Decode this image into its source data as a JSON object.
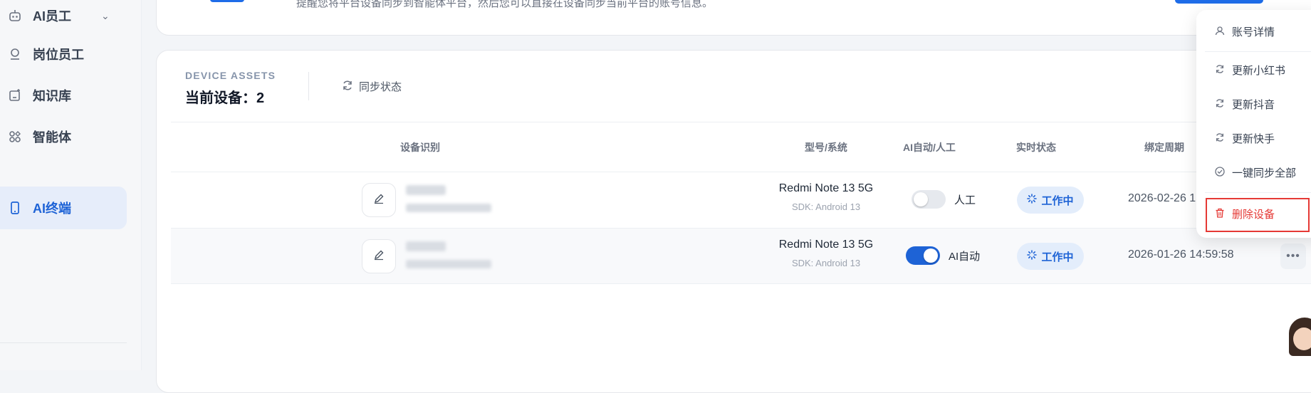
{
  "sidebar": {
    "items": [
      {
        "label": "AI员工",
        "icon": "robot-icon"
      },
      {
        "label": "岗位员工",
        "icon": "user-icon"
      },
      {
        "label": "知识库",
        "icon": "knowledge-base-icon"
      },
      {
        "label": "智能体",
        "icon": "agent-apps-icon"
      },
      {
        "label": "AI终端",
        "icon": "phone-icon",
        "active": true
      }
    ]
  },
  "top_banner": {
    "text": "提醒您将平台设备同步到智能体平台，然后您可以直接在设备同步当前平台的账号信息。"
  },
  "assets": {
    "eyebrow": "DEVICE ASSETS",
    "current_devices": "当前设备：2",
    "sync_label": "同步状态"
  },
  "table": {
    "headers": {
      "device_id": "设备识别",
      "model": "型号/系统",
      "ai_mode": "AI自动/人工",
      "status": "实时状态",
      "bind_period": "绑定周期"
    },
    "rows": [
      {
        "model": "Redmi Note 13 5G",
        "sdk": "SDK: Android 13",
        "mode_label": "人工",
        "ai_auto": false,
        "status": "工作中",
        "bind_date": "2026-02-26 13:"
      },
      {
        "model": "Redmi Note 13 5G",
        "sdk": "SDK: Android 13",
        "mode_label": "AI自动",
        "ai_auto": true,
        "status": "工作中",
        "bind_date": "2026-01-26 14:59:58"
      }
    ]
  },
  "dropdown": {
    "items": [
      {
        "label": "账号详情",
        "icon": "user-icon"
      },
      {
        "label": "更新小红书",
        "icon": "refresh-icon"
      },
      {
        "label": "更新抖音",
        "icon": "refresh-icon"
      },
      {
        "label": "更新快手",
        "icon": "refresh-icon"
      },
      {
        "label": "一键同步全部",
        "icon": "check-circle-icon"
      },
      {
        "label": "删除设备",
        "icon": "trash-icon",
        "danger": true
      }
    ]
  },
  "colors": {
    "accent": "#1e63d6",
    "danger": "#e53935",
    "status_bg": "#e3edfb"
  }
}
